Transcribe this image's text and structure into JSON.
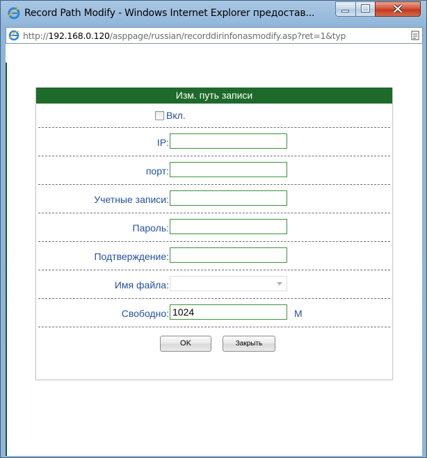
{
  "window": {
    "title": "Record Path Modify - Windows Internet Explorer предостав...",
    "url_prefix": "http://",
    "url_host": "192.168.0.120",
    "url_rest": "/asppage/russian/recorddirinfonasmodify.asp?ret=1&typ"
  },
  "dialog": {
    "header": "Изм. путь записи",
    "enable_label": "Вкл.",
    "fields": {
      "ip_label": "IP:",
      "port_label": "порт:",
      "account_label": "Учетные записи:",
      "password_label": "Пароль:",
      "confirm_label": "Подтверждение:",
      "filename_label": "Имя файла:",
      "free_label": "Свободно:",
      "free_value": "1024",
      "free_unit": "M"
    },
    "buttons": {
      "ok": "OK",
      "close": "Закрыть"
    }
  },
  "colors": {
    "header_bg": "#1d6a2a",
    "label_text": "#2251a3",
    "input_border": "#3c8f3c"
  }
}
